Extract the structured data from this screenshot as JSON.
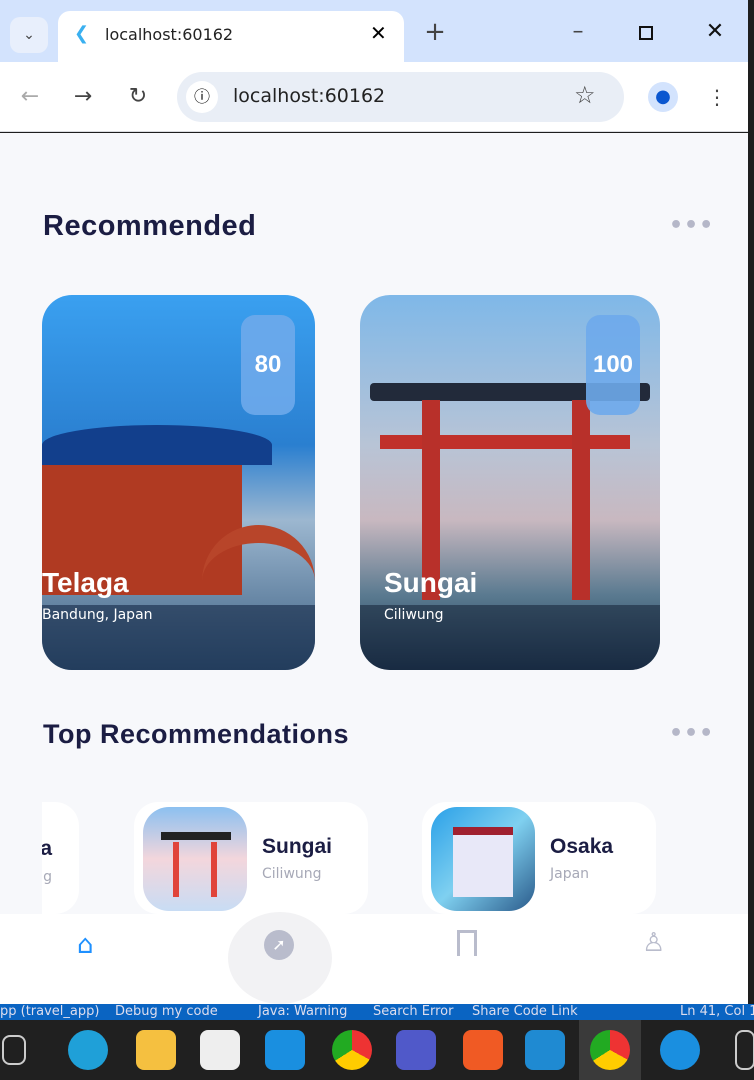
{
  "browser": {
    "tab_title": "localhost:60162",
    "url": "localhost:60162"
  },
  "recommended": {
    "title": "Recommended",
    "items": [
      {
        "name": "Telaga",
        "location": "Bandung, Japan",
        "rating": "80"
      },
      {
        "name": "Sungai",
        "location": "Ciliwung",
        "rating": "100"
      }
    ]
  },
  "top": {
    "title": "Top Recommendations",
    "items": [
      {
        "name": "Telaga",
        "location": "Bandung"
      },
      {
        "name": "Sungai",
        "location": "Ciliwung"
      },
      {
        "name": "Osaka",
        "location": "Japan"
      }
    ]
  },
  "nav": {
    "items": [
      "home",
      "explore",
      "bookmark",
      "profile"
    ],
    "active": "home",
    "active_color": "#1e90ff",
    "inactive_color": "#b9bccc"
  },
  "statusbar": {
    "items": [
      "pp (travel_app)",
      "Debug my code",
      "Java: Warning",
      "Search Error",
      "Share Code Link",
      "Ln 41, Col 1"
    ]
  }
}
